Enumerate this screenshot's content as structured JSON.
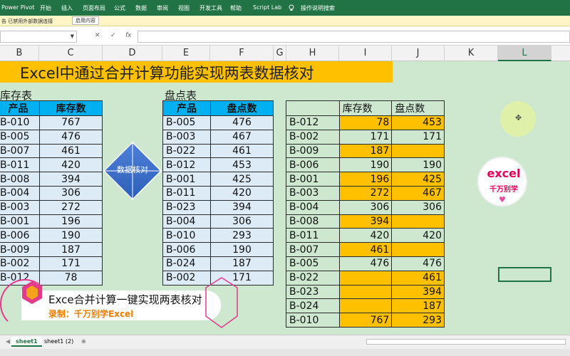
{
  "ribbon": {
    "tabs": [
      "Power Pivot",
      "开始",
      "插入",
      "页面布局",
      "公式",
      "数据",
      "审阅",
      "视图",
      "开发工具",
      "帮助",
      "Script Lab",
      "操作说明搜索"
    ]
  },
  "infobar": {
    "message": "告  已禁用外部数据连接",
    "button": "启用内容"
  },
  "formula_bar": {
    "cancel_icon": "✕",
    "confirm_icon": "✓",
    "fx_label": "fx",
    "value": ""
  },
  "columns": [
    "B",
    "C",
    "D",
    "E",
    "F",
    "G",
    "H",
    "I",
    "J",
    "K",
    "L"
  ],
  "title": "Excel中通过合并计算功能实现两表数据核对",
  "inventory": {
    "label": "库存表",
    "headers": [
      "产品",
      "库存数"
    ],
    "rows": [
      [
        "B-010",
        "767"
      ],
      [
        "B-005",
        "476"
      ],
      [
        "B-007",
        "461"
      ],
      [
        "B-011",
        "420"
      ],
      [
        "B-008",
        "394"
      ],
      [
        "B-004",
        "306"
      ],
      [
        "B-003",
        "272"
      ],
      [
        "B-001",
        "196"
      ],
      [
        "B-006",
        "190"
      ],
      [
        "B-009",
        "187"
      ],
      [
        "B-002",
        "171"
      ],
      [
        "B-012",
        "78"
      ]
    ]
  },
  "stocktake": {
    "label": "盘点表",
    "headers": [
      "产品",
      "盘点数"
    ],
    "rows": [
      [
        "B-005",
        "476"
      ],
      [
        "B-003",
        "467"
      ],
      [
        "B-022",
        "461"
      ],
      [
        "B-012",
        "453"
      ],
      [
        "B-001",
        "425"
      ],
      [
        "B-011",
        "420"
      ],
      [
        "B-023",
        "394"
      ],
      [
        "B-004",
        "306"
      ],
      [
        "B-010",
        "293"
      ],
      [
        "B-006",
        "190"
      ],
      [
        "B-024",
        "187"
      ],
      [
        "B-002",
        "171"
      ]
    ]
  },
  "diamond_label": "数据核对",
  "merged": {
    "headers": [
      "",
      "库存数",
      "盘点数"
    ],
    "rows": [
      {
        "code": "B-012",
        "inv": "78",
        "cnt": "453",
        "hl": true
      },
      {
        "code": "B-002",
        "inv": "171",
        "cnt": "171",
        "hl": false
      },
      {
        "code": "B-009",
        "inv": "187",
        "cnt": "",
        "hl": true
      },
      {
        "code": "B-006",
        "inv": "190",
        "cnt": "190",
        "hl": false
      },
      {
        "code": "B-001",
        "inv": "196",
        "cnt": "425",
        "hl": true
      },
      {
        "code": "B-003",
        "inv": "272",
        "cnt": "467",
        "hl": true
      },
      {
        "code": "B-004",
        "inv": "306",
        "cnt": "306",
        "hl": false
      },
      {
        "code": "B-008",
        "inv": "394",
        "cnt": "",
        "hl": true
      },
      {
        "code": "B-011",
        "inv": "420",
        "cnt": "420",
        "hl": false
      },
      {
        "code": "B-007",
        "inv": "461",
        "cnt": "",
        "hl": true
      },
      {
        "code": "B-005",
        "inv": "476",
        "cnt": "476",
        "hl": false
      },
      {
        "code": "B-022",
        "inv": "",
        "cnt": "461",
        "hl": true
      },
      {
        "code": "B-023",
        "inv": "",
        "cnt": "394",
        "hl": true
      },
      {
        "code": "B-024",
        "inv": "",
        "cnt": "187",
        "hl": true
      },
      {
        "code": "B-010",
        "inv": "767",
        "cnt": "293",
        "hl": true
      }
    ]
  },
  "logo": {
    "line1": "excel",
    "line2": "千万别学"
  },
  "banner": {
    "title": "Exce合并计算一键实现两表核对",
    "subtitle": "录制：千万别学Excel"
  },
  "sheets": [
    "sheet1",
    "sheet1 (2)"
  ],
  "colors": {
    "accent": "#217346",
    "highlight": "#ffc000",
    "header_blue": "#00b0f0",
    "cell_blue": "#ddebf7",
    "sheet_bg": "#cde8cf"
  }
}
